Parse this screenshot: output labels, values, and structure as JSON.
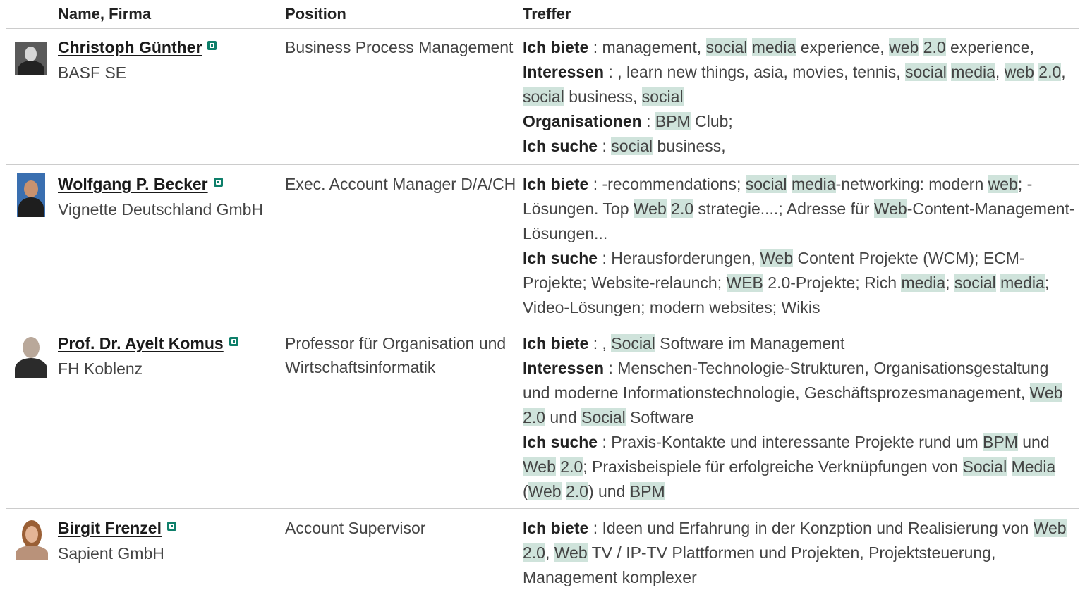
{
  "columns": {
    "name": "Name, Firma",
    "position": "Position",
    "hits": "Treffer"
  },
  "highlight_color": "#cfe3db",
  "accent_color": "#0e7f6a",
  "people": [
    {
      "name": "Christoph Günther",
      "company": "BASF SE",
      "position": "Business Process Management",
      "avatar": "portrait-man-dark-suit",
      "hits": [
        {
          "label": "Ich biete",
          "sep": " : ",
          "parts": [
            [
              "management, ",
              0
            ],
            [
              "social",
              1
            ],
            [
              " ",
              0
            ],
            [
              "media",
              1
            ],
            [
              " experience, ",
              0
            ],
            [
              "web",
              1
            ],
            [
              " ",
              0
            ],
            [
              "2.0",
              1
            ],
            [
              " experience,",
              0
            ]
          ]
        },
        {
          "label": "Interessen",
          "sep": " : ",
          "parts": [
            [
              ", learn new things, asia, movies, tennis, ",
              0
            ],
            [
              "social",
              1
            ],
            [
              " ",
              0
            ],
            [
              "media",
              1
            ],
            [
              ", ",
              0
            ],
            [
              "web",
              1
            ],
            [
              " ",
              0
            ],
            [
              "2.0",
              1
            ],
            [
              ", ",
              0
            ],
            [
              "social",
              1
            ],
            [
              " business, ",
              0
            ],
            [
              "social",
              1
            ]
          ]
        },
        {
          "label": "Organisationen",
          "sep": " : ",
          "parts": [
            [
              "BPM",
              1
            ],
            [
              " Club;",
              0
            ]
          ]
        },
        {
          "label": "Ich suche",
          "sep": " : ",
          "parts": [
            [
              "social",
              1
            ],
            [
              " business,",
              0
            ]
          ]
        }
      ]
    },
    {
      "name": "Wolfgang P. Becker",
      "company": "Vignette Deutschland GmbH",
      "position": "Exec. Account Manager D/A/CH",
      "avatar": "portrait-man-blue-background",
      "hits": [
        {
          "label": "Ich biete",
          "sep": " : ",
          "parts": [
            [
              "-recommendations; ",
              0
            ],
            [
              "social",
              1
            ],
            [
              " ",
              0
            ],
            [
              "media",
              1
            ],
            [
              "-networking: modern ",
              0
            ],
            [
              "web",
              1
            ],
            [
              "; -Lösungen. Top ",
              0
            ],
            [
              "Web",
              1
            ],
            [
              " ",
              0
            ],
            [
              "2.0",
              1
            ],
            [
              " strategie....; Adresse für ",
              0
            ],
            [
              "Web",
              1
            ],
            [
              "-Content-Management-Lösungen...",
              0
            ]
          ]
        },
        {
          "label": "Ich suche",
          "sep": " : ",
          "parts": [
            [
              "Herausforderungen, ",
              0
            ],
            [
              "Web",
              1
            ],
            [
              " Content Projekte (WCM); ECM-Projekte; Website-relaunch; ",
              0
            ],
            [
              "WEB",
              1
            ],
            [
              " 2.0-Projekte; Rich ",
              0
            ],
            [
              "media",
              1
            ],
            [
              "; ",
              0
            ],
            [
              "social",
              1
            ],
            [
              " ",
              0
            ],
            [
              "media",
              1
            ],
            [
              "; Video-Lösungen; modern websites; Wikis",
              0
            ]
          ]
        }
      ]
    },
    {
      "name": "Prof. Dr. Ayelt Komus",
      "company": "FH Koblenz",
      "position": "Professor für Organisation und Wirtschaftsinformatik",
      "avatar": "portrait-man-glasses",
      "hits": [
        {
          "label": "Ich biete",
          "sep": " : ",
          "parts": [
            [
              ", ",
              0
            ],
            [
              "Social",
              1
            ],
            [
              " Software im Management",
              0
            ]
          ]
        },
        {
          "label": "Interessen",
          "sep": " : ",
          "parts": [
            [
              "Menschen-Technologie-Strukturen, Organisationsgestaltung und moderne Informationstechnologie, Geschäftsprozesmanagement, ",
              0
            ],
            [
              "Web",
              1
            ],
            [
              " ",
              0
            ],
            [
              "2.0",
              1
            ],
            [
              " und ",
              0
            ],
            [
              "Social",
              1
            ],
            [
              " Software",
              0
            ]
          ]
        },
        {
          "label": "Ich suche",
          "sep": " : ",
          "parts": [
            [
              "Praxis-Kontakte und interessante Projekte rund um ",
              0
            ],
            [
              "BPM",
              1
            ],
            [
              " und ",
              0
            ],
            [
              "Web",
              1
            ],
            [
              " ",
              0
            ],
            [
              "2.0",
              1
            ],
            [
              "; Praxisbeispiele für erfolgreiche Verknüpfungen von ",
              0
            ],
            [
              "Social",
              1
            ],
            [
              " ",
              0
            ],
            [
              "Media",
              1
            ],
            [
              " (",
              0
            ],
            [
              "Web",
              1
            ],
            [
              " ",
              0
            ],
            [
              "2.0",
              1
            ],
            [
              ") und ",
              0
            ],
            [
              "BPM",
              1
            ]
          ]
        }
      ]
    },
    {
      "name": "Birgit Frenzel",
      "company": "Sapient GmbH",
      "position": "Account Supervisor",
      "avatar": "portrait-woman",
      "hits": [
        {
          "label": "Ich biete",
          "sep": " : ",
          "parts": [
            [
              "Ideen und Erfahrung in der Konzption und Realisierung von ",
              0
            ],
            [
              "Web",
              1
            ],
            [
              " ",
              0
            ],
            [
              "2.0",
              1
            ],
            [
              ", ",
              0
            ],
            [
              "Web",
              1
            ],
            [
              " TV / IP-TV Plattformen und Projekten, Projektsteuerung, Management komplexer",
              0
            ]
          ]
        }
      ]
    }
  ]
}
